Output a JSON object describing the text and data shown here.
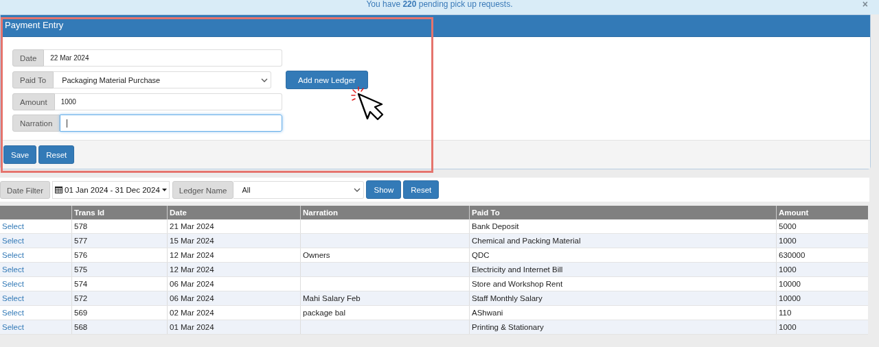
{
  "alert": {
    "text": "You have **220** pending pick up requests.",
    "close": "×"
  },
  "payment_panel": {
    "title": "Payment Entry",
    "highlighted": true,
    "fields": [
      {
        "label": "Date",
        "kind": "text",
        "value": "22 Mar 2024",
        "focused": false
      },
      {
        "label": "Paid To",
        "kind": "select",
        "value": "Packaging Material Purchase",
        "focused": false,
        "action": "Add new Ledger"
      },
      {
        "label": "Amount",
        "kind": "text",
        "value": "1000",
        "focused": false
      },
      {
        "label": "Narration",
        "kind": "text",
        "focused": true
      }
    ],
    "buttons": [
      "Save",
      "Reset"
    ]
  },
  "filter": {
    "date_label": "Date Filter",
    "date_range": "01 Jan 2024 - 31 Dec 2024",
    "ledger_label": "Ledger Name",
    "ledger_value": "All",
    "buttons": [
      "Show",
      "Reset"
    ]
  },
  "table": {
    "columns": [
      "Trans Id",
      "Date",
      "Narration",
      "Paid To",
      "Amount"
    ],
    "rows": [
      {
        "action": "Select",
        "cells": [
          "578",
          "21 Mar 2024",
          "",
          "Bank Deposit",
          "5000"
        ]
      },
      {
        "action": "Select",
        "cells": [
          "577",
          "15 Mar 2024",
          "",
          "Chemical and Packing Material",
          "1000"
        ]
      },
      {
        "action": "Select",
        "cells": [
          "576",
          "12 Mar 2024",
          "Owners",
          "QDC",
          "630000"
        ]
      },
      {
        "action": "Select",
        "cells": [
          "575",
          "12 Mar 2024",
          "",
          "Electricity and Internet Bill",
          "1000"
        ]
      },
      {
        "action": "Select",
        "cells": [
          "574",
          "06 Mar 2024",
          "",
          "Store and Workshop Rent",
          "10000"
        ]
      },
      {
        "action": "Select",
        "cells": [
          "572",
          "06 Mar 2024",
          "Mahi Salary Feb",
          "Staff Monthly Salary",
          "10000"
        ]
      },
      {
        "action": "Select",
        "cells": [
          "569",
          "02 Mar 2024",
          "package bal",
          "AShwani",
          "110"
        ]
      },
      {
        "action": "Select",
        "cells": [
          "568",
          "01 Mar 2024",
          "",
          "Printing & Stationary",
          "1000"
        ]
      }
    ]
  }
}
